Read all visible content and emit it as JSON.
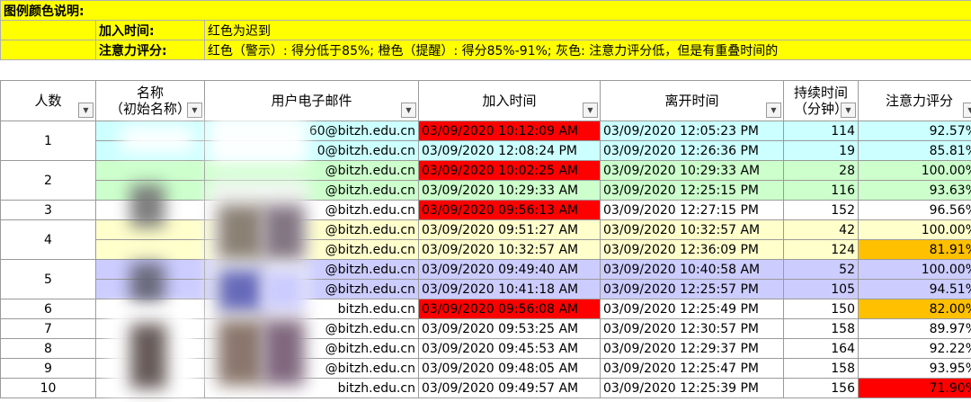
{
  "legend": {
    "title": "图例颜色说明:",
    "join_label": "加入时间:",
    "join_desc": "红色为迟到",
    "attention_label": "注意力评分:",
    "attention_desc": "红色（警示）: 得分低于85%; 橙色（提醒）: 得分85%-91%; 灰色: 注意力评分低，但是有重叠时间的"
  },
  "headers": {
    "num": "人数",
    "name_line1": "名称",
    "name_line2": "（初始名称）",
    "email": "用户电子邮件",
    "join": "加入时间",
    "leave": "离开时间",
    "duration_line1": "持续时间",
    "duration_line2": "（分钟）",
    "score": "注意力评分"
  },
  "rows": [
    {
      "num": "1",
      "email": "60@bitzh.edu.cn",
      "join": "03/09/2020 10:12:09 AM",
      "leave": "03/09/2020 12:05:23 PM",
      "duration": "114",
      "score": "92.57%"
    },
    {
      "num": "",
      "email": "0@bitzh.edu.cn",
      "join": "03/09/2020 12:08:24 PM",
      "leave": "03/09/2020 12:26:36 PM",
      "duration": "19",
      "score": "85.81%"
    },
    {
      "num": "2",
      "email": "@bitzh.edu.cn",
      "join": "03/09/2020 10:02:25 AM",
      "leave": "03/09/2020 10:29:33 AM",
      "duration": "28",
      "score": "100.00%"
    },
    {
      "num": "",
      "email": "@bitzh.edu.cn",
      "join": "03/09/2020 10:29:33 AM",
      "leave": "03/09/2020 12:25:15 PM",
      "duration": "116",
      "score": "93.63%"
    },
    {
      "num": "3",
      "email": "@bitzh.edu.cn",
      "join": "03/09/2020 09:56:13 AM",
      "leave": "03/09/2020 12:27:15 PM",
      "duration": "152",
      "score": "96.56%"
    },
    {
      "num": "4",
      "email": "@bitzh.edu.cn",
      "join": "03/09/2020 09:51:27 AM",
      "leave": "03/09/2020 10:32:57 AM",
      "duration": "42",
      "score": "100.00%"
    },
    {
      "num": "",
      "email": "@bitzh.edu.cn",
      "join": "03/09/2020 10:32:57 AM",
      "leave": "03/09/2020 12:36:09 PM",
      "duration": "124",
      "score": "81.91%"
    },
    {
      "num": "5",
      "email": "@bitzh.edu.cn",
      "join": "03/09/2020 09:49:40 AM",
      "leave": "03/09/2020 10:40:58 AM",
      "duration": "52",
      "score": "100.00%"
    },
    {
      "num": "",
      "email": "@bitzh.edu.cn",
      "join": "03/09/2020 10:41:18 AM",
      "leave": "03/09/2020 12:25:57 PM",
      "duration": "105",
      "score": "94.51%"
    },
    {
      "num": "6",
      "email": "bitzh.edu.cn",
      "join": "03/09/2020 09:56:08 AM",
      "leave": "03/09/2020 12:25:49 PM",
      "duration": "150",
      "score": "82.00%"
    },
    {
      "num": "7",
      "email": "@bitzh.edu.cn",
      "join": "03/09/2020 09:53:25 AM",
      "leave": "03/09/2020 12:30:57 PM",
      "duration": "158",
      "score": "89.97%"
    },
    {
      "num": "8",
      "email": "@bitzh.edu.cn",
      "join": "03/09/2020 09:45:53 AM",
      "leave": "03/09/2020 12:29:37 PM",
      "duration": "164",
      "score": "92.22%"
    },
    {
      "num": "9",
      "email": "@bitzh.edu.cn",
      "join": "03/09/2020 09:48:05 AM",
      "leave": "03/09/2020 12:25:47 PM",
      "duration": "158",
      "score": "93.95%"
    },
    {
      "num": "10",
      "email": "bitzh.edu.cn",
      "join": "03/09/2020 09:49:57 AM",
      "leave": "03/09/2020 12:25:39 PM",
      "duration": "156",
      "score": "71.90%"
    }
  ],
  "colors": {
    "legend_bg": "#ffff00",
    "late_red": "#ff0000",
    "remind_orange": "#ffc000",
    "group1": "#ccffff",
    "group2": "#ccffcc",
    "group4": "#ffffcc",
    "group5": "#ccccff"
  },
  "icons": {
    "filter": "filter-dropdown-icon"
  }
}
